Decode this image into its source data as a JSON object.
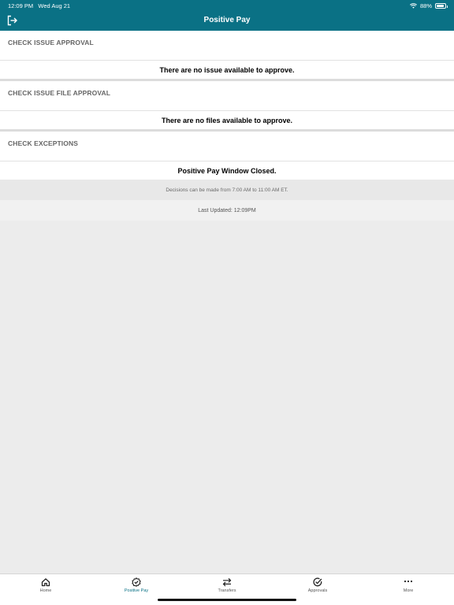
{
  "status": {
    "time": "12:09 PM",
    "date": "Wed Aug 21",
    "battery": "88%",
    "battery_level": 0.88
  },
  "header": {
    "title": "Positive Pay",
    "logout_icon": "logout-icon"
  },
  "sections": [
    {
      "title": "CHECK ISSUE APPROVAL",
      "message": "There are no issue available to approve."
    },
    {
      "title": "CHECK ISSUE FILE APPROVAL",
      "message": "There are no files available to approve."
    },
    {
      "title": "CHECK EXCEPTIONS",
      "message": "Positive Pay Window Closed."
    }
  ],
  "footer": {
    "decisions_note": "Decisions can be made from 7:00 AM to 11:00 AM ET.",
    "last_updated": "Last Updated: 12:09PM"
  },
  "tabs": [
    {
      "label": "Home",
      "icon": "home-icon",
      "active": false
    },
    {
      "label": "Positive Pay",
      "icon": "check-badge-icon",
      "active": true
    },
    {
      "label": "Transfers",
      "icon": "transfer-arrows-icon",
      "active": false
    },
    {
      "label": "Approvals",
      "icon": "check-circle-icon",
      "active": false
    },
    {
      "label": "More",
      "icon": "more-dots-icon",
      "active": false
    }
  ],
  "colors": {
    "brand": "#0a7185",
    "background": "#ececec"
  }
}
